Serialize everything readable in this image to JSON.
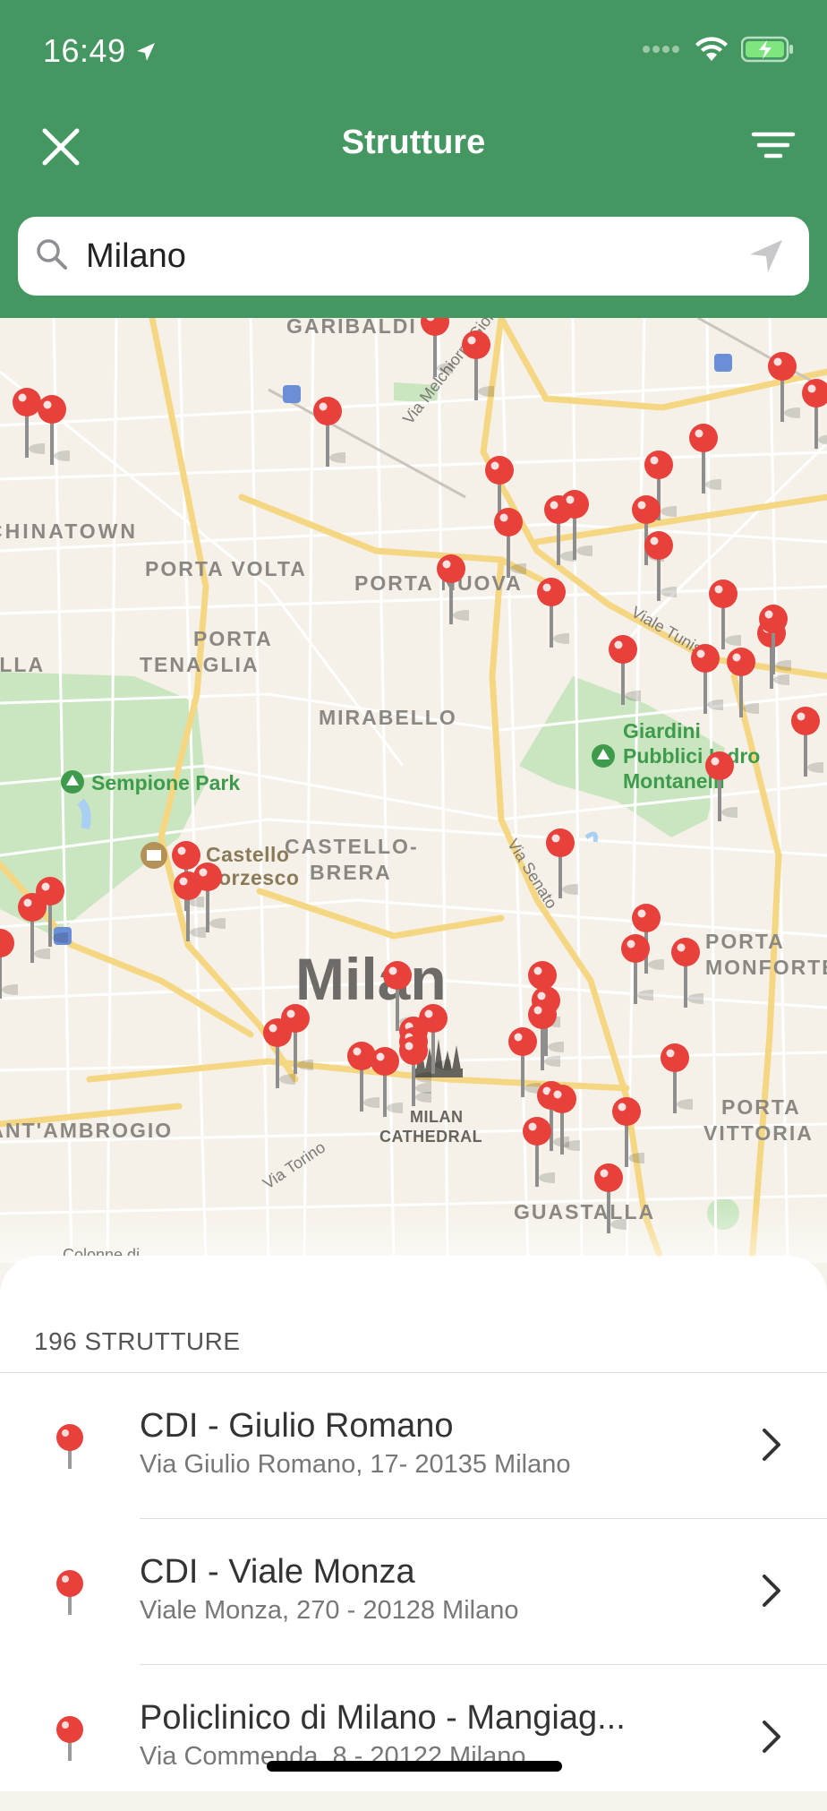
{
  "status": {
    "time": "16:49"
  },
  "header": {
    "title": "Strutture"
  },
  "search": {
    "value": "Milano"
  },
  "map": {
    "city_label": "Milan",
    "districts": [
      "GARIBALDI",
      "CHINATOWN",
      "PORTA VOLTA",
      "PORTA NUOVA",
      "PORTA",
      "TENAGLIA",
      "MIRABELLO",
      "CASTELLO-",
      "BRERA",
      "PORTA",
      "MONFORTE",
      "PORTA",
      "VITTORIA",
      "SANT'AMBROGIO",
      "GUASTALLA",
      "ELLA"
    ],
    "parks": [
      "Sempione Park",
      "Giardini",
      "Pubblici Indro",
      "Montanelli"
    ],
    "landmarks": [
      "Castello",
      "Sforzesco",
      "MILAN",
      "CATHEDRAL"
    ],
    "streets": [
      "Via Melchiorre Gioia",
      "Viale Tunisia",
      "Via Senato",
      "Via Torino",
      "Colonne di"
    ]
  },
  "list": {
    "count_label": "196 STRUTTURE",
    "items": [
      {
        "name": "CDI - Giulio Romano",
        "address": "Via Giulio Romano, 17- 20135 Milano"
      },
      {
        "name": "CDI - Viale Monza",
        "address": "Viale Monza, 270 - 20128 Milano"
      },
      {
        "name": "Policlinico di Milano - Mangiag...",
        "address": "Via Commenda, 8 - 20122 Milano"
      }
    ]
  },
  "colors": {
    "header_green": "#459762",
    "pin_red": "#e8413b",
    "park_green": "#c8e6bf",
    "water": "#a9d0f2"
  }
}
